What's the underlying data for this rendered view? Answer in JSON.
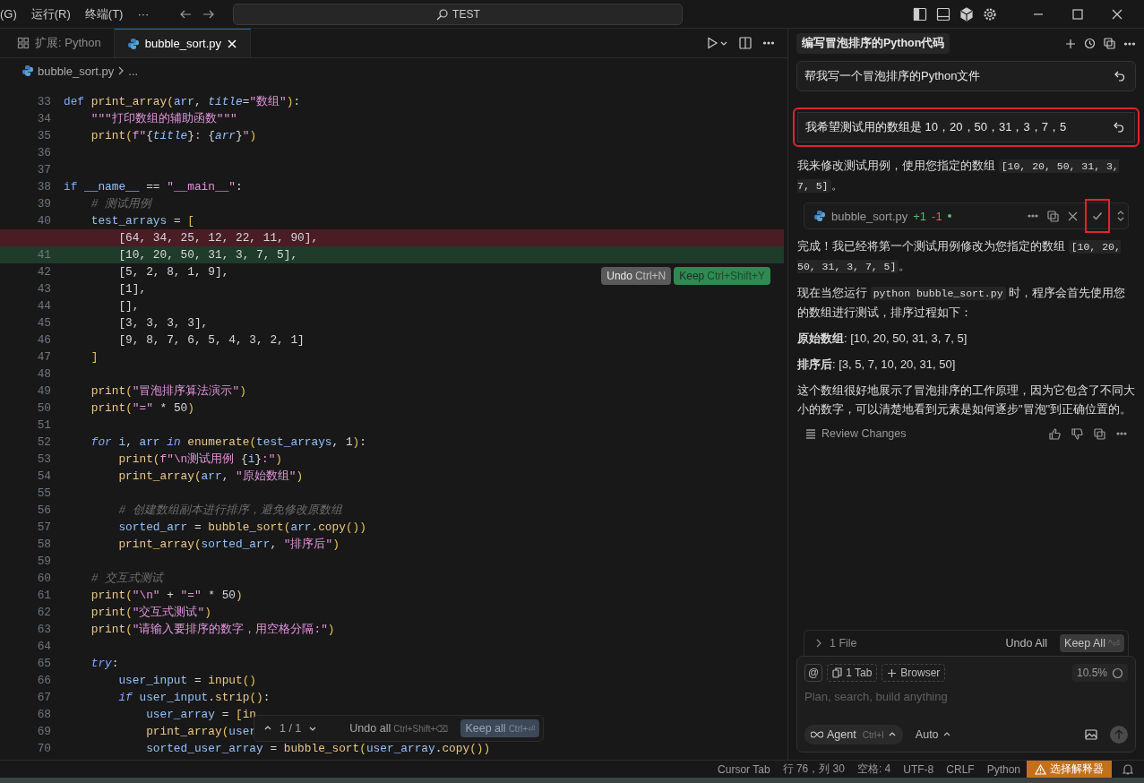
{
  "menu": [
    "(G)",
    "运行(R)",
    "终端(T)",
    "···"
  ],
  "search": {
    "text": "TEST"
  },
  "editor_tabs": [
    {
      "label": "扩展: Python",
      "kind": "extension",
      "selected": false
    },
    {
      "label": "bubble_sort.py",
      "kind": "python",
      "selected": true
    }
  ],
  "breadcrumb": {
    "file": "bubble_sort.py",
    "rest": "..."
  },
  "code_lines": [
    {
      "no": "33",
      "kind": "normal",
      "tokens": [
        {
          "kind": "kw",
          "text": "def "
        },
        {
          "kind": "f",
          "text": "print_array"
        },
        {
          "kind": "br",
          "text": "("
        },
        {
          "kind": "v",
          "text": "arr"
        },
        {
          "kind": "p",
          "text": ", "
        },
        {
          "kind": "i",
          "text": "title"
        },
        {
          "kind": "p",
          "text": "="
        },
        {
          "kind": "s",
          "text": "\"数组\""
        },
        {
          "kind": "br",
          "text": ")"
        },
        {
          "kind": "p",
          "text": ":"
        }
      ]
    },
    {
      "no": "34",
      "kind": "normal",
      "tokens": [
        {
          "kind": "s",
          "text": "    \"\"\"打印数组的辅助函数\"\"\""
        }
      ]
    },
    {
      "no": "35",
      "kind": "normal",
      "tokens": [
        {
          "kind": "f",
          "text": "    print"
        },
        {
          "kind": "br",
          "text": "("
        },
        {
          "kind": "s",
          "text": "f\""
        },
        {
          "kind": "p",
          "text": "{"
        },
        {
          "kind": "i",
          "text": "title"
        },
        {
          "kind": "p",
          "text": "}"
        },
        {
          "kind": "s",
          "text": ": "
        },
        {
          "kind": "p",
          "text": "{"
        },
        {
          "kind": "i",
          "text": "arr"
        },
        {
          "kind": "p",
          "text": "}"
        },
        {
          "kind": "s",
          "text": "\""
        },
        {
          "kind": "br",
          "text": ")"
        }
      ]
    },
    {
      "no": "36",
      "kind": "normal"
    },
    {
      "no": "37",
      "kind": "normal"
    },
    {
      "no": "38",
      "kind": "normal",
      "tokens": [
        {
          "kind": "kw",
          "text": "if "
        },
        {
          "kind": "v",
          "text": "__name__"
        },
        {
          "kind": "p",
          "text": " == "
        },
        {
          "kind": "s",
          "text": "\"__main__\""
        },
        {
          "kind": "p",
          "text": ":"
        }
      ]
    },
    {
      "no": "39",
      "kind": "normal",
      "tokens": [
        {
          "kind": "c",
          "text": "    # 测试用例"
        }
      ]
    },
    {
      "no": "40",
      "kind": "normal",
      "tokens": [
        {
          "kind": "v",
          "text": "    test_arrays"
        },
        {
          "kind": "p",
          "text": " = "
        },
        {
          "kind": "br",
          "text": "["
        }
      ]
    },
    {
      "kind": "removed",
      "tokens": [
        {
          "kind": "p",
          "text": "        [64, 34, 25, 12, 22, 11, 90],"
        }
      ]
    },
    {
      "no": "41",
      "kind": "added",
      "tokens": [
        {
          "kind": "p",
          "text": "        [10, 20, 50, 31, 3, 7, 5],"
        }
      ]
    },
    {
      "no": "42",
      "kind": "normal",
      "tokens": [
        {
          "kind": "p",
          "text": "        [5, 2, 8, 1, 9],"
        }
      ]
    },
    {
      "no": "43",
      "kind": "normal",
      "tokens": [
        {
          "kind": "p",
          "text": "        [1],"
        }
      ]
    },
    {
      "no": "44",
      "kind": "normal",
      "tokens": [
        {
          "kind": "p",
          "text": "        [],"
        }
      ]
    },
    {
      "no": "45",
      "kind": "normal",
      "tokens": [
        {
          "kind": "p",
          "text": "        [3, 3, 3, 3],"
        }
      ]
    },
    {
      "no": "46",
      "kind": "normal",
      "tokens": [
        {
          "kind": "p",
          "text": "        [9, 8, 7, 6, 5, 4, 3, 2, 1]"
        }
      ]
    },
    {
      "no": "47",
      "kind": "normal",
      "tokens": [
        {
          "kind": "br",
          "text": "    ]"
        }
      ]
    },
    {
      "no": "48",
      "kind": "normal"
    },
    {
      "no": "49",
      "kind": "normal",
      "tokens": [
        {
          "kind": "f",
          "text": "    print"
        },
        {
          "kind": "br",
          "text": "("
        },
        {
          "kind": "s",
          "text": "\"冒泡排序算法演示\""
        },
        {
          "kind": "br",
          "text": ")"
        }
      ]
    },
    {
      "no": "50",
      "kind": "normal",
      "tokens": [
        {
          "kind": "f",
          "text": "    print"
        },
        {
          "kind": "br",
          "text": "("
        },
        {
          "kind": "s",
          "text": "\"=\""
        },
        {
          "kind": "p",
          "text": " * 50"
        },
        {
          "kind": "br",
          "text": ")"
        }
      ]
    },
    {
      "no": "51",
      "kind": "normal"
    },
    {
      "no": "52",
      "kind": "normal",
      "tokens": [
        {
          "kind": "ctl",
          "text": "    for "
        },
        {
          "kind": "v",
          "text": "i"
        },
        {
          "kind": "p",
          "text": ", "
        },
        {
          "kind": "v",
          "text": "arr "
        },
        {
          "kind": "ctl",
          "text": "in "
        },
        {
          "kind": "f",
          "text": "enumerate"
        },
        {
          "kind": "br",
          "text": "("
        },
        {
          "kind": "v",
          "text": "test_arrays"
        },
        {
          "kind": "p",
          "text": ", 1"
        },
        {
          "kind": "br",
          "text": ")"
        },
        {
          "kind": "p",
          "text": ":"
        }
      ]
    },
    {
      "no": "53",
      "kind": "normal",
      "tokens": [
        {
          "kind": "f",
          "text": "        print"
        },
        {
          "kind": "br",
          "text": "("
        },
        {
          "kind": "s",
          "text": "f\"\\n测试用例 "
        },
        {
          "kind": "p",
          "text": "{"
        },
        {
          "kind": "v",
          "text": "i"
        },
        {
          "kind": "p",
          "text": "}"
        },
        {
          "kind": "s",
          "text": ":\""
        },
        {
          "kind": "br",
          "text": ")"
        }
      ]
    },
    {
      "no": "54",
      "kind": "normal",
      "tokens": [
        {
          "kind": "f",
          "text": "        print_array"
        },
        {
          "kind": "br",
          "text": "("
        },
        {
          "kind": "v",
          "text": "arr"
        },
        {
          "kind": "p",
          "text": ", "
        },
        {
          "kind": "s",
          "text": "\"原始数组\""
        },
        {
          "kind": "br",
          "text": ")"
        }
      ]
    },
    {
      "no": "55",
      "kind": "normal"
    },
    {
      "no": "56",
      "kind": "normal",
      "tokens": [
        {
          "kind": "c",
          "text": "        # 创建数组副本进行排序，避免修改原数组"
        }
      ]
    },
    {
      "no": "57",
      "kind": "normal",
      "tokens": [
        {
          "kind": "v",
          "text": "        sorted_arr"
        },
        {
          "kind": "p",
          "text": " = "
        },
        {
          "kind": "f",
          "text": "bubble_sort"
        },
        {
          "kind": "br",
          "text": "("
        },
        {
          "kind": "v",
          "text": "arr"
        },
        {
          "kind": "p",
          "text": "."
        },
        {
          "kind": "f",
          "text": "copy"
        },
        {
          "kind": "br",
          "text": "())"
        }
      ]
    },
    {
      "no": "58",
      "kind": "normal",
      "tokens": [
        {
          "kind": "f",
          "text": "        print_array"
        },
        {
          "kind": "br",
          "text": "("
        },
        {
          "kind": "v",
          "text": "sorted_arr"
        },
        {
          "kind": "p",
          "text": ", "
        },
        {
          "kind": "s",
          "text": "\"排序后\""
        },
        {
          "kind": "br",
          "text": ")"
        }
      ]
    },
    {
      "no": "59",
      "kind": "normal"
    },
    {
      "no": "60",
      "kind": "normal",
      "tokens": [
        {
          "kind": "c",
          "text": "    # 交互式测试"
        }
      ]
    },
    {
      "no": "61",
      "kind": "normal",
      "tokens": [
        {
          "kind": "f",
          "text": "    print"
        },
        {
          "kind": "br",
          "text": "("
        },
        {
          "kind": "s",
          "text": "\"\\n\""
        },
        {
          "kind": "p",
          "text": " + "
        },
        {
          "kind": "s",
          "text": "\"=\""
        },
        {
          "kind": "p",
          "text": " * 50"
        },
        {
          "kind": "br",
          "text": ")"
        }
      ]
    },
    {
      "no": "62",
      "kind": "normal",
      "tokens": [
        {
          "kind": "f",
          "text": "    print"
        },
        {
          "kind": "br",
          "text": "("
        },
        {
          "kind": "s",
          "text": "\"交互式测试\""
        },
        {
          "kind": "br",
          "text": ")"
        }
      ]
    },
    {
      "no": "63",
      "kind": "normal",
      "tokens": [
        {
          "kind": "f",
          "text": "    print"
        },
        {
          "kind": "br",
          "text": "("
        },
        {
          "kind": "s",
          "text": "\"请输入要排序的数字，用空格分隔:\""
        },
        {
          "kind": "br",
          "text": ")"
        }
      ]
    },
    {
      "no": "64",
      "kind": "normal"
    },
    {
      "no": "65",
      "kind": "normal",
      "tokens": [
        {
          "kind": "ctl",
          "text": "    try"
        },
        {
          "kind": "p",
          "text": ":"
        }
      ]
    },
    {
      "no": "66",
      "kind": "normal",
      "tokens": [
        {
          "kind": "v",
          "text": "        user_input"
        },
        {
          "kind": "p",
          "text": " = "
        },
        {
          "kind": "f",
          "text": "input"
        },
        {
          "kind": "br",
          "text": "()"
        }
      ]
    },
    {
      "no": "67",
      "kind": "normal",
      "tokens": [
        {
          "kind": "ctl",
          "text": "        if "
        },
        {
          "kind": "v",
          "text": "user_input"
        },
        {
          "kind": "p",
          "text": "."
        },
        {
          "kind": "f",
          "text": "strip"
        },
        {
          "kind": "br",
          "text": "()"
        },
        {
          "kind": "p",
          "text": ":"
        }
      ]
    },
    {
      "no": "68",
      "kind": "normal",
      "tokens": [
        {
          "kind": "v",
          "text": "            user_array"
        },
        {
          "kind": "p",
          "text": " = "
        },
        {
          "kind": "br",
          "text": "["
        },
        {
          "kind": "f",
          "text": "in"
        }
      ]
    },
    {
      "no": "69",
      "kind": "normal",
      "tokens": [
        {
          "kind": "f",
          "text": "            print_array"
        },
        {
          "kind": "br",
          "text": "("
        },
        {
          "kind": "v",
          "text": "user"
        }
      ]
    },
    {
      "no": "70",
      "kind": "normal",
      "tokens": [
        {
          "kind": "v",
          "text": "            sorted_user_array"
        },
        {
          "kind": "p",
          "text": " = "
        },
        {
          "kind": "f",
          "text": "bubble_sort"
        },
        {
          "kind": "br",
          "text": "("
        },
        {
          "kind": "v",
          "text": "user_array"
        },
        {
          "kind": "p",
          "text": "."
        },
        {
          "kind": "f",
          "text": "copy"
        },
        {
          "kind": "br",
          "text": "())"
        }
      ]
    }
  ],
  "inline_actions": [
    {
      "kind": "undo",
      "label": "Undo",
      "shortcut": "Ctrl+N"
    },
    {
      "kind": "keep",
      "label": "Keep",
      "shortcut": "Ctrl+Shift+Y"
    }
  ],
  "diff_bar": {
    "position": "1 / 1",
    "undo": {
      "label": "Undo all",
      "shortcut": "Ctrl+Shift+⌫"
    },
    "keep": {
      "label": "Keep all",
      "shortcut": "Ctrl+⏎"
    }
  },
  "chat": {
    "title": "编写冒泡排序的Python代码",
    "items": [
      {
        "kind": "user",
        "text": "帮我写一个冒泡排序的Python文件",
        "highlighted": false
      },
      {
        "kind": "user",
        "text": "我希望测试用的数组是 10，20，50，31，3，7，5",
        "highlighted": true
      },
      {
        "kind": "para",
        "segments": [
          {
            "kind": "text",
            "text": "我来修改测试用例，使用您指定的数组 "
          },
          {
            "kind": "code",
            "text": "[10, 20, 50, 31, 3, 7, 5]"
          },
          {
            "kind": "text",
            "text": "。"
          }
        ]
      },
      {
        "kind": "file",
        "name": "bubble_sort.py",
        "added": "+1",
        "removed": "-1",
        "accept_highlighted": true
      },
      {
        "kind": "para",
        "segments": [
          {
            "kind": "text",
            "text": "完成！我已经将第一个测试用例修改为您指定的数组 "
          },
          {
            "kind": "code",
            "text": "[10, 20, 50, 31, 3, 7, 5]"
          },
          {
            "kind": "text",
            "text": "。"
          }
        ]
      },
      {
        "kind": "para",
        "segments": [
          {
            "kind": "text",
            "text": "现在当您运行 "
          },
          {
            "kind": "code",
            "text": "python bubble_sort.py"
          },
          {
            "kind": "text",
            "text": " 时，程序会首先使用您的数组进行测试，排序过程如下："
          }
        ]
      },
      {
        "kind": "para",
        "segments": [
          {
            "kind": "text",
            "text": "**原始数组**: [10, 20, 50, 31, 3, 7, 5]"
          }
        ]
      },
      {
        "kind": "para",
        "segments": [
          {
            "kind": "text",
            "text": "**排序后**: [3, 5, 7, 10, 20, 31, 50]"
          }
        ]
      },
      {
        "kind": "para",
        "segments": [
          {
            "kind": "text",
            "text": "这个数组很好地展示了冒泡排序的工作原理，因为它包含了不同大小的数字，可以清楚地看到元素是如何逐步\"冒泡\"到正确位置的。"
          }
        ]
      }
    ],
    "review": "Review Changes"
  },
  "pending": {
    "files": "1 File",
    "undo": "Undo All",
    "keep": "Keep All",
    "keep_shortcut": "^⏎"
  },
  "composer": {
    "chips": [
      {
        "kind": "mention",
        "label": "@"
      },
      {
        "kind": "tab",
        "label": "1 Tab"
      },
      {
        "kind": "browser",
        "label": "Browser"
      }
    ],
    "usage": "10.5%",
    "placeholder": "Plan, search, build anything",
    "mode": "Agent",
    "mode_shortcut": "Ctrl+I",
    "model": "Auto"
  },
  "status_bar": {
    "items": [
      "Cursor Tab",
      "行 76，列 30",
      "空格: 4",
      "UTF-8",
      "CRLF",
      "Python"
    ],
    "warning": "选择解释器"
  }
}
